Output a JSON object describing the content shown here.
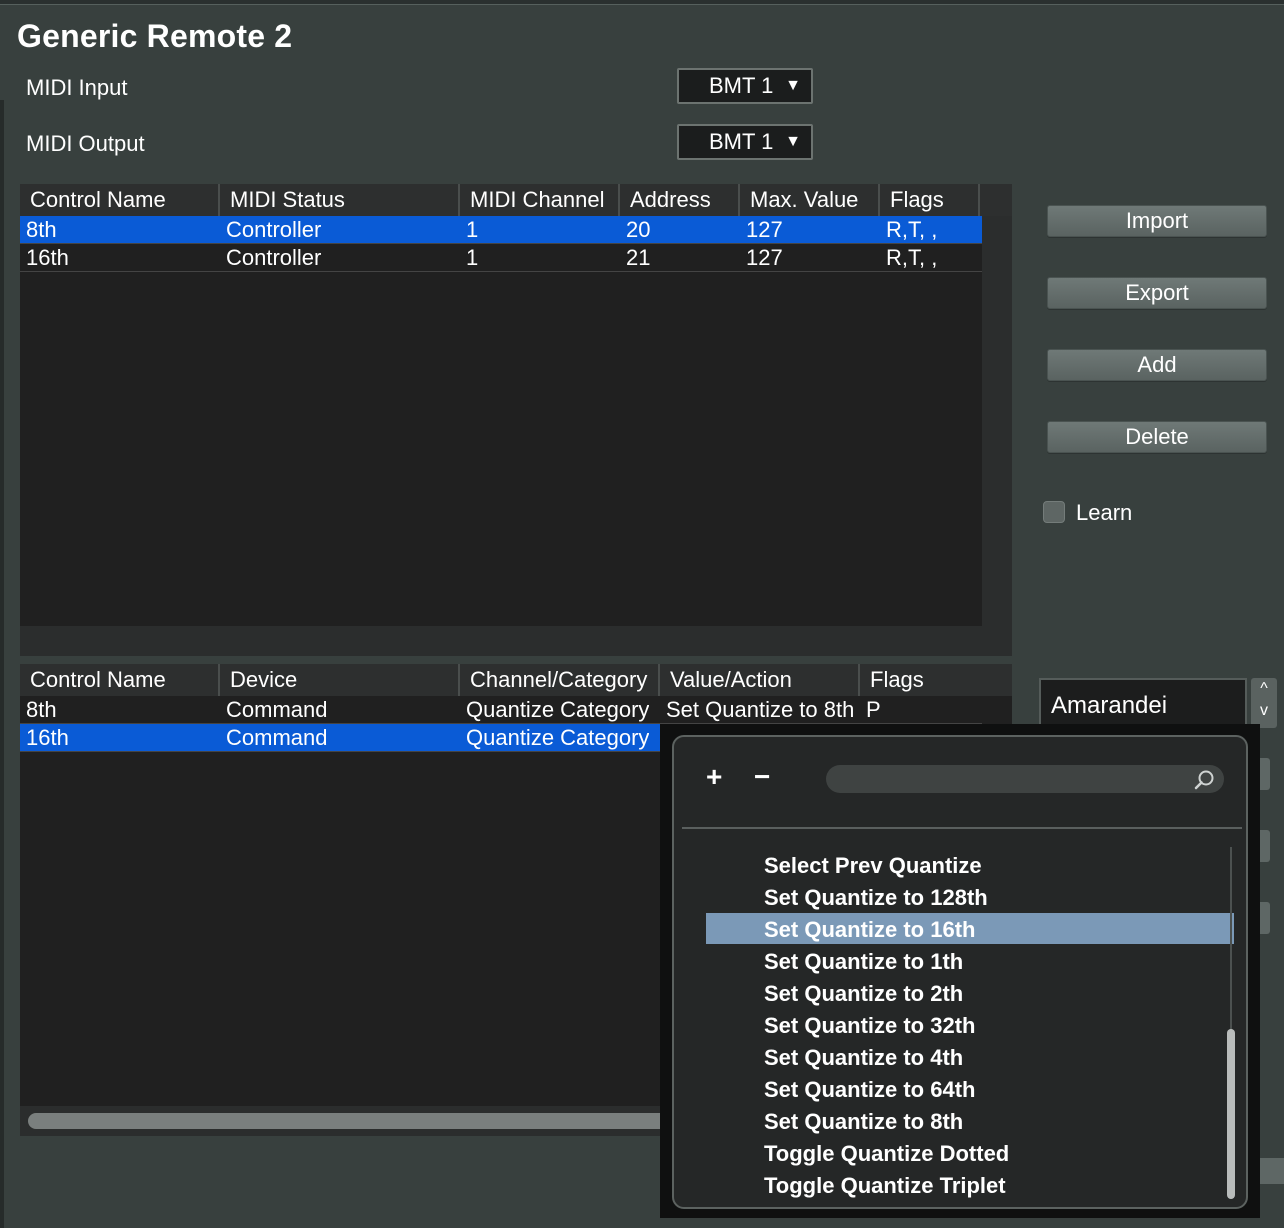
{
  "title": "Generic Remote 2",
  "midi_input": {
    "label": "MIDI Input",
    "value": "BMT 1"
  },
  "midi_output": {
    "label": "MIDI Output",
    "value": "BMT 1"
  },
  "dropdown_arrow": "▼",
  "controls_table": {
    "headers": [
      "Control Name",
      "MIDI Status",
      "MIDI Channel",
      "Address",
      "Max. Value",
      "Flags"
    ],
    "rows": [
      {
        "name": "8th",
        "status": "Controller",
        "channel": "1",
        "address": "20",
        "max": "127",
        "flags": "R,T, ,",
        "selected": true
      },
      {
        "name": "16th",
        "status": "Controller",
        "channel": "1",
        "address": "21",
        "max": "127",
        "flags": "R,T, ,",
        "selected": false
      }
    ]
  },
  "assign_table": {
    "headers": [
      "Control Name",
      "Device",
      "Channel/Category",
      "Value/Action",
      "Flags"
    ],
    "rows": [
      {
        "name": "8th",
        "device": "Command",
        "category": "Quantize Category",
        "action": "Set Quantize to 8th",
        "flags": "P",
        "selected": false
      },
      {
        "name": "16th",
        "device": "Command",
        "category": "Quantize Category",
        "action": "",
        "flags": "",
        "selected": true
      }
    ]
  },
  "buttons": {
    "import": "Import",
    "export": "Export",
    "add": "Add",
    "delete": "Delete"
  },
  "learn": {
    "label": "Learn",
    "checked": false
  },
  "bank": {
    "value": "Amarandei",
    "up": "^",
    "down": "v"
  },
  "popup": {
    "add_label": "+",
    "remove_label": "−",
    "search_placeholder": "",
    "items": [
      "Select Prev Quantize",
      "Set Quantize to 128th",
      "Set Quantize to 16th",
      "Set Quantize to 1th",
      "Set Quantize to 2th",
      "Set Quantize to 32th",
      "Set Quantize to 4th",
      "Set Quantize to 64th",
      "Set Quantize to 8th",
      "Toggle Quantize Dotted",
      "Toggle Quantize Triplet"
    ],
    "highlighted_item": "Set Quantize to 16th"
  },
  "colors": {
    "background": "#38403e",
    "selection": "#0a5bd6",
    "popup_highlight": "#7b99b7",
    "table_bg": "#202020"
  },
  "icons": {
    "search": "search-icon",
    "dropdown": "chevron-down-icon"
  }
}
